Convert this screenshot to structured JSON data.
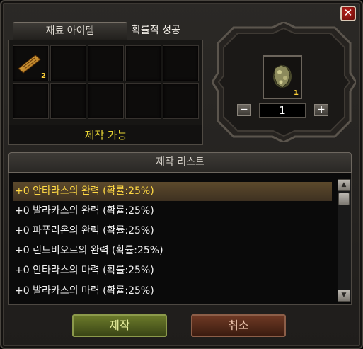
{
  "window": {
    "close_label": "✕"
  },
  "tabs": [
    {
      "label": "재료 아이템",
      "active": true
    },
    {
      "label": "확률적 성공",
      "active": false
    }
  ],
  "materials": {
    "slots_count": 10,
    "item": {
      "icon": "scroll-icon",
      "count": "2"
    },
    "status": "제작 가능"
  },
  "result": {
    "icon": "armor-icon",
    "count": "1",
    "quantity": "1",
    "minus": "−",
    "plus": "+"
  },
  "craft_list": {
    "title": "제작 리스트",
    "items": [
      "+0 안타라스의 완력 (확률:25%)",
      "+0 발라카스의 완력 (확률:25%)",
      "+0 파푸리온의 완력 (확률:25%)",
      "+0 린드비오르의 완력 (확률:25%)",
      "+0 안타라스의 마력 (확률:25%)",
      "+0 발라카스의 마력 (확률:25%)"
    ],
    "selected_index": 0,
    "scroll_up": "▲",
    "scroll_down": "▼"
  },
  "buttons": {
    "craft": "제작",
    "cancel": "취소"
  },
  "colors": {
    "highlight_text": "#ffd944",
    "craftable_text": "#e8d534",
    "accent_close": "#b7201a"
  }
}
